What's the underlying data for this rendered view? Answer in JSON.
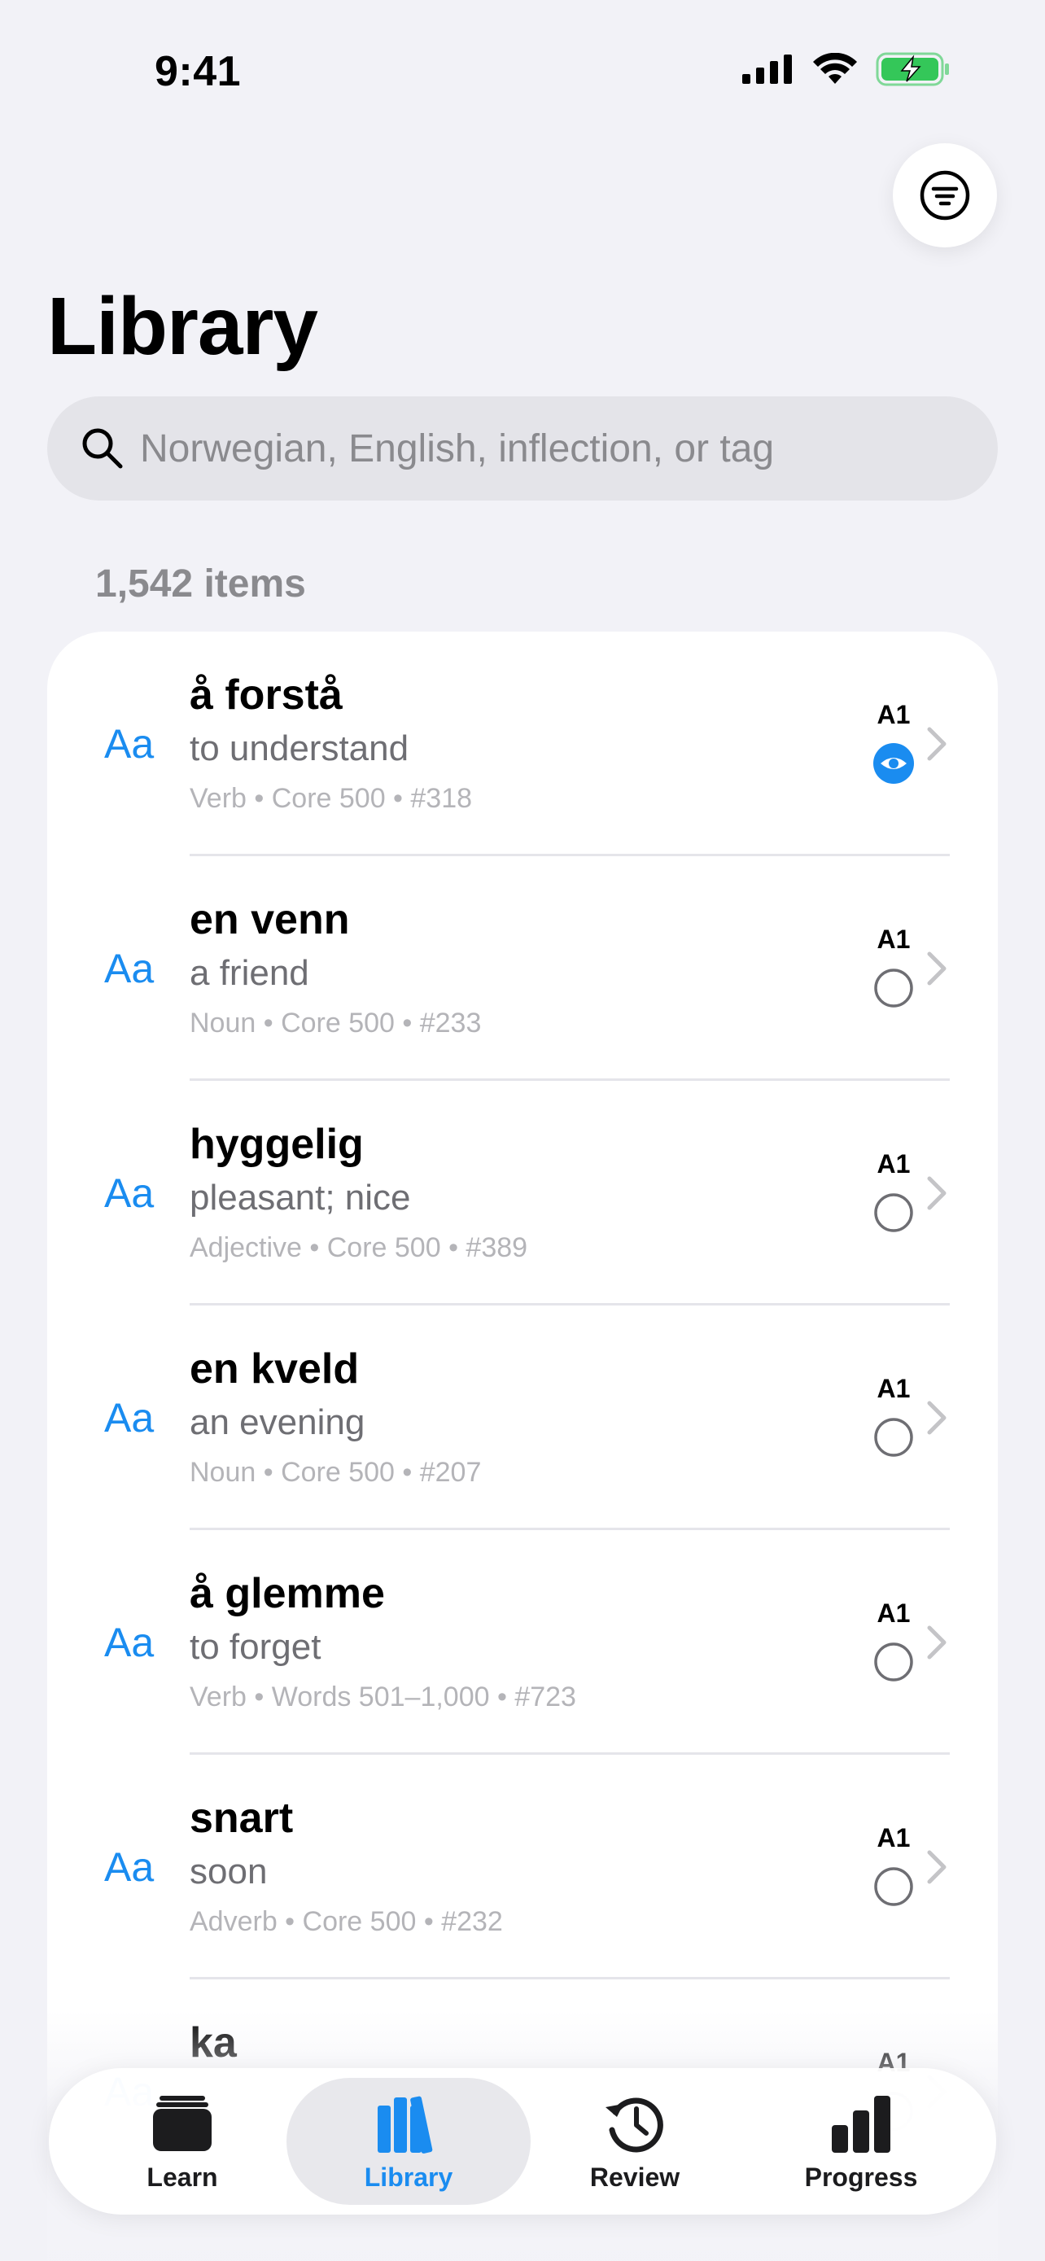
{
  "status_bar": {
    "time": "9:41"
  },
  "header": {
    "title": "Library"
  },
  "search": {
    "placeholder": "Norwegian, English, inflection, or tag",
    "value": ""
  },
  "list": {
    "count_label": "1,542 items",
    "rows": [
      {
        "icon_text": "Aa",
        "word": "å forstå",
        "meaning": "to understand",
        "meta": "Verb • Core 500 • #318",
        "level": "A1",
        "status": "seen"
      },
      {
        "icon_text": "Aa",
        "word": "en venn",
        "meaning": "a friend",
        "meta": "Noun • Core 500 • #233",
        "level": "A1",
        "status": "unseen"
      },
      {
        "icon_text": "Aa",
        "word": "hyggelig",
        "meaning": "pleasant; nice",
        "meta": "Adjective • Core 500 • #389",
        "level": "A1",
        "status": "unseen"
      },
      {
        "icon_text": "Aa",
        "word": "en kveld",
        "meaning": "an evening",
        "meta": "Noun • Core 500 • #207",
        "level": "A1",
        "status": "unseen"
      },
      {
        "icon_text": "Aa",
        "word": "å glemme",
        "meaning": "to forget",
        "meta": "Verb • Words 501–1,000 • #723",
        "level": "A1",
        "status": "unseen"
      },
      {
        "icon_text": "Aa",
        "word": "snart",
        "meaning": "soon",
        "meta": "Adverb • Core 500 • #232",
        "level": "A1",
        "status": "unseen"
      },
      {
        "icon_text": "Aa",
        "word": "ka",
        "meaning": "",
        "meta": "",
        "level": "A1",
        "status": "unseen"
      }
    ]
  },
  "tab_bar": {
    "tabs": [
      {
        "label": "Learn",
        "icon": "cards-icon",
        "active": false
      },
      {
        "label": "Library",
        "icon": "books-icon",
        "active": true
      },
      {
        "label": "Review",
        "icon": "history-icon",
        "active": false
      },
      {
        "label": "Progress",
        "icon": "bar-chart-icon",
        "active": false
      }
    ]
  },
  "colors": {
    "accent": "#1a8cf0",
    "background": "#f2f2f7",
    "battery": "#34c759"
  }
}
